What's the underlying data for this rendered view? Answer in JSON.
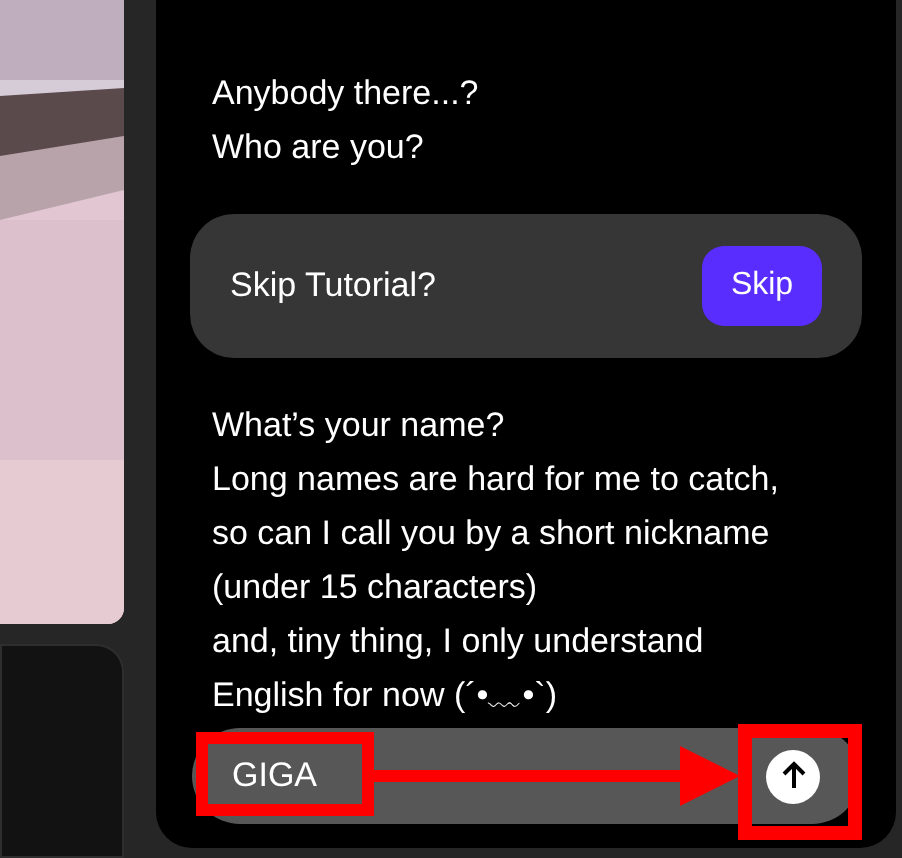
{
  "messages": [
    {
      "kind": "text",
      "lines": [
        "Anybody there...?",
        "Who are you?"
      ]
    },
    {
      "kind": "prompt",
      "label": "Skip Tutorial?",
      "button": "Skip"
    },
    {
      "kind": "text",
      "lines": [
        "What’s your name?",
        "Long names are hard for me to catch,",
        "so can I call you by a short nickname",
        "(under 15 characters)",
        "and, tiny thing, I only understand",
        "English for now (´•﹏•`)"
      ]
    }
  ],
  "input": {
    "value": "GIGA"
  },
  "annotation": {
    "color": "#ff0000"
  }
}
